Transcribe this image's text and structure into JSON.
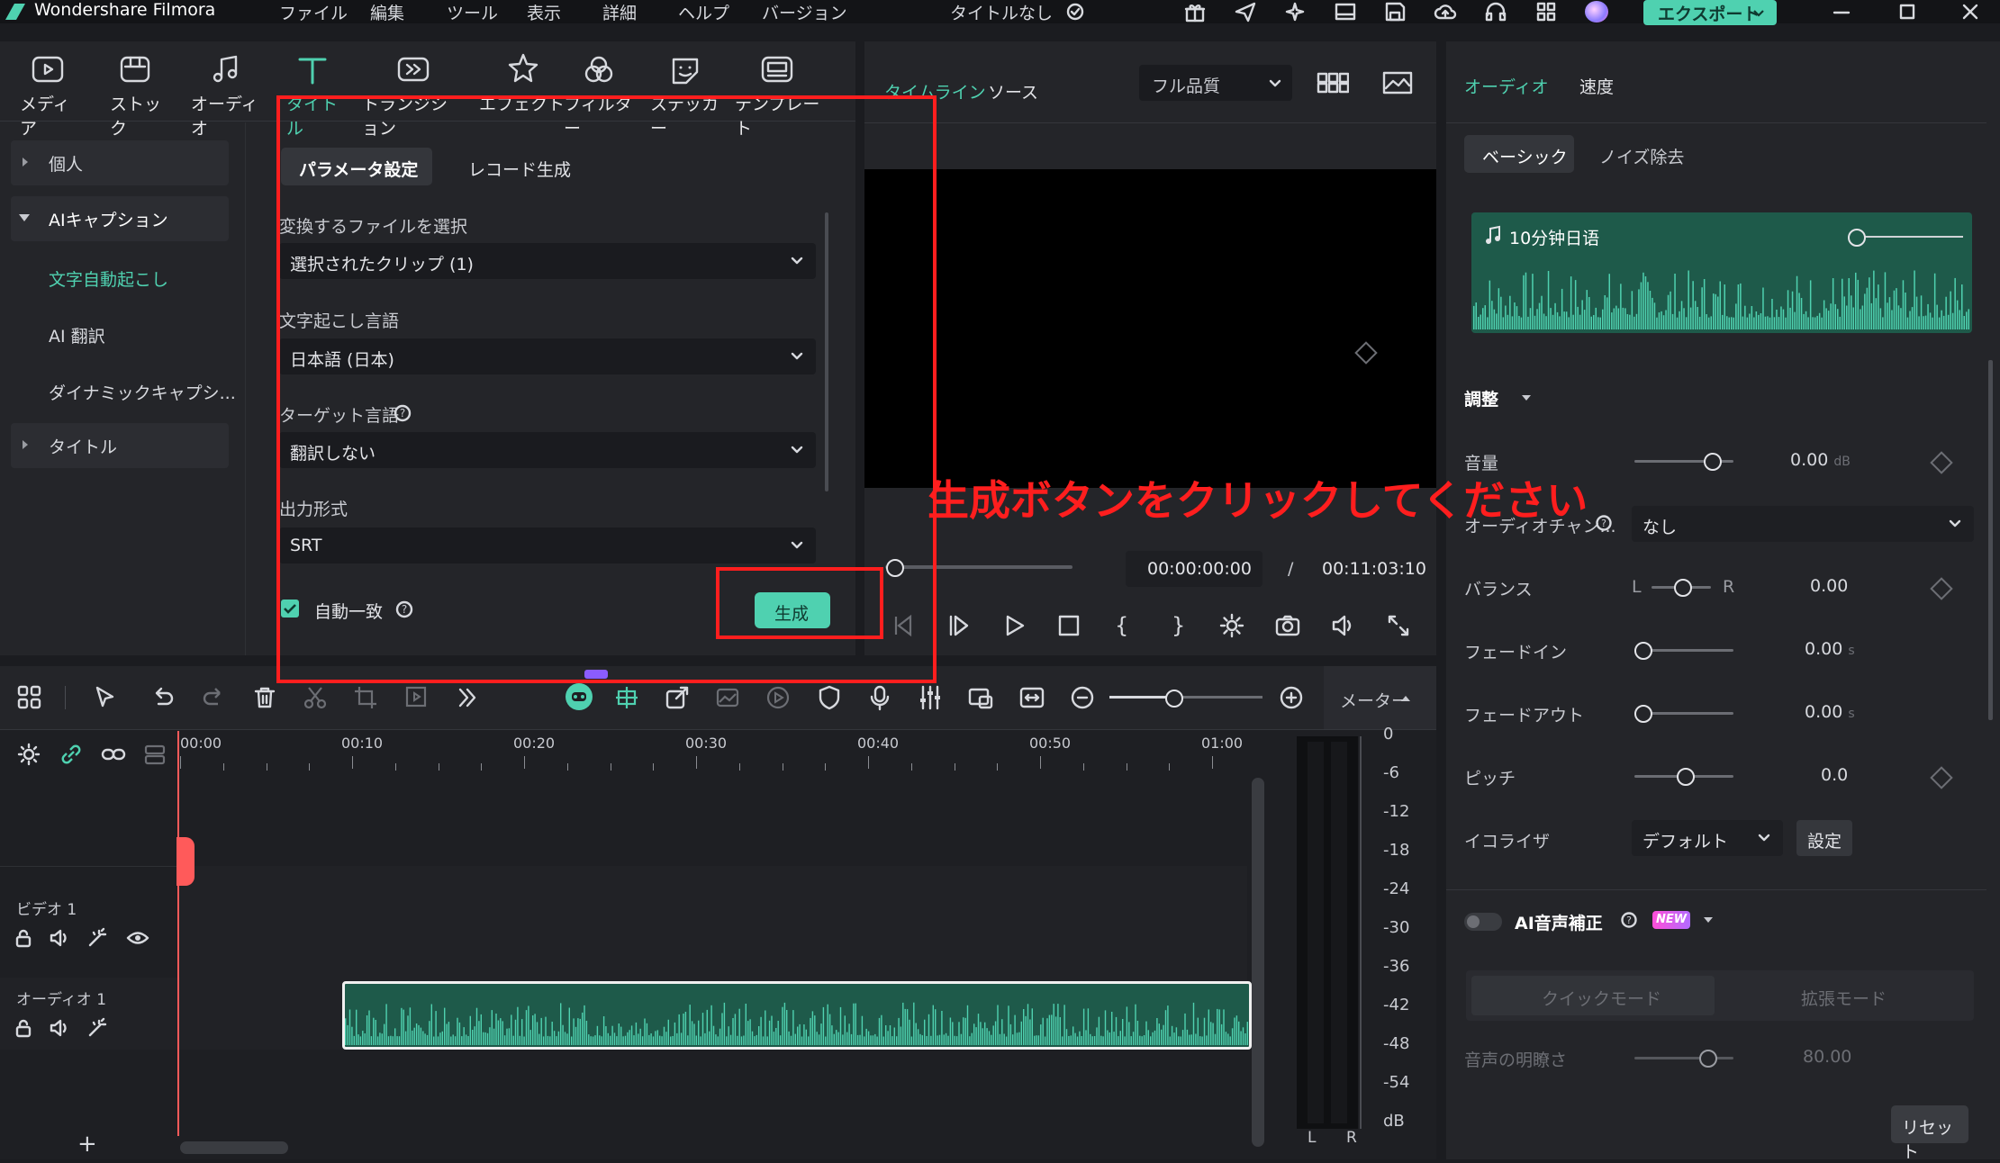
{
  "app": {
    "name": "Wondershare Filmora",
    "project_title": "タイトルなし",
    "export_label": "エクスポート"
  },
  "menu": [
    "ファイル",
    "編集",
    "ツール",
    "表示",
    "詳細",
    "ヘルプ",
    "バージョン"
  ],
  "media_tabs": [
    {
      "label": "メディア",
      "icon": "media-icon"
    },
    {
      "label": "ストック",
      "icon": "stock-icon"
    },
    {
      "label": "オーディオ",
      "icon": "audio-icon"
    },
    {
      "label": "タイトル",
      "icon": "title-icon"
    },
    {
      "label": "トランジション",
      "icon": "transition-icon"
    },
    {
      "label": "エフェクト",
      "icon": "effect-icon"
    },
    {
      "label": "フィルター",
      "icon": "filter-icon"
    },
    {
      "label": "ステッカー",
      "icon": "sticker-icon"
    },
    {
      "label": "テンプレート",
      "icon": "template-icon"
    }
  ],
  "sidebar": {
    "personal": "個人",
    "ai_caption": "AIキャプション",
    "auto_transcribe": "文字自動起こし",
    "ai_translate": "AI 翻訳",
    "dynamic_caption": "ダイナミックキャプシ...",
    "title": "タイトル"
  },
  "caption_panel": {
    "tab_params": "パラメータ設定",
    "tab_record": "レコード生成",
    "file_label": "変換するファイルを選択",
    "file_value": "選択されたクリップ (1)",
    "lang_label": "文字起こし言語",
    "lang_value": "日本語 (日本)",
    "target_label": "ターゲット言語",
    "target_value": "翻訳しない",
    "format_label": "出力形式",
    "format_value": "SRT",
    "auto_match": "自動一致",
    "generate": "生成"
  },
  "preview": {
    "tab_timeline": "タイムライン",
    "tab_source": "ソース",
    "quality": "フル品質",
    "current_time": "00:00:00:00",
    "separator": "/",
    "total_time": "00:11:03:10"
  },
  "annotation": "生成ボタンをクリックしてください",
  "right_panel": {
    "tab_audio": "オーディオ",
    "tab_speed": "速度",
    "sub_basic": "ベーシック",
    "sub_noise": "ノイズ除去",
    "clip_name": "10分钟日语",
    "adjust": "調整",
    "volume_label": "音量",
    "volume_value": "0.00",
    "volume_unit": "dB",
    "volume_level": 0.6,
    "channel_label": "オーディオチャン...",
    "channel_value": "なし",
    "balance_label": "バランス",
    "balance_l": "L",
    "balance_r": "R",
    "balance_value": "0.00",
    "balance_level": 0.5,
    "fadein_label": "フェードイン",
    "fadein_value": "0.00",
    "fadein_unit": "s",
    "fadein_level": 0.0,
    "fadeout_label": "フェードアウト",
    "fadeout_value": "0.00",
    "fadeout_unit": "s",
    "fadeout_level": 0.0,
    "pitch_label": "ピッチ",
    "pitch_value": "0.0",
    "pitch_level": 0.5,
    "eq_label": "イコライザ",
    "eq_value": "デフォルト",
    "eq_button": "設定",
    "ai_voice_label": "AI音声補正",
    "new_badge": "NEW",
    "quick_mode": "クイックモード",
    "extended_mode": "拡張モード",
    "clarity_label": "音声の明瞭さ",
    "clarity_value": "80.00",
    "clarity_level": 0.8,
    "reset": "リセット"
  },
  "timeline": {
    "meter_label": "メーター",
    "ruler": [
      "00:00",
      "00:10",
      "00:20",
      "00:30",
      "00:40",
      "00:50",
      "01:00"
    ],
    "video_track": "ビデオ 1",
    "audio_track": "オーディオ 1",
    "meter_scale": [
      "0",
      "-6",
      "-12",
      "-18",
      "-24",
      "-30",
      "-36",
      "-42",
      "-48",
      "-54",
      "dB"
    ],
    "meter_l": "L",
    "meter_r": "R",
    "add_track": "+"
  },
  "colors": {
    "accent": "#4fd1b0",
    "annotation": "#ff1e1e",
    "background": "#1b1c20",
    "panel": "#242529"
  }
}
